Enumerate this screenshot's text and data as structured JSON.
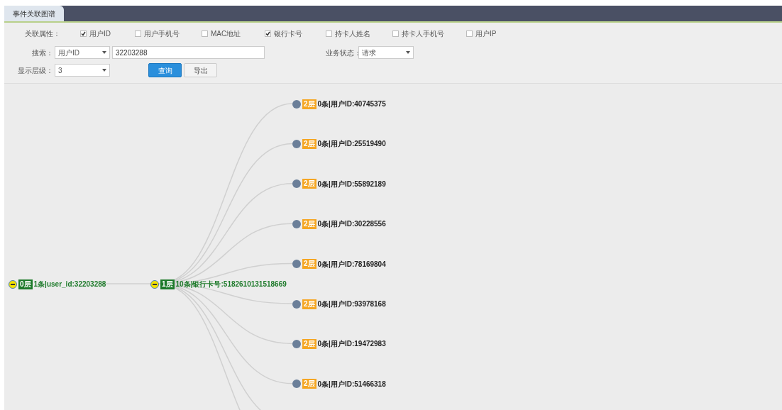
{
  "tabs": [
    {
      "label": "事件关联图谱",
      "selected": true
    }
  ],
  "form": {
    "attributes_label": "关联属性：",
    "attributes": [
      {
        "label": "用户ID",
        "checked": true
      },
      {
        "label": "用户手机号",
        "checked": false
      },
      {
        "label": "MAC地址",
        "checked": false
      },
      {
        "label": "银行卡号",
        "checked": true
      },
      {
        "label": "持卡人姓名",
        "checked": false
      },
      {
        "label": "持卡人手机号",
        "checked": false
      },
      {
        "label": "用户IP",
        "checked": false
      }
    ],
    "search_label": "搜索：",
    "search_type": "用户ID",
    "search_value": "32203288",
    "status_label": "业务状态：",
    "status_value": "请求",
    "depth_label": "显示层级：",
    "depth_value": "3",
    "buttons": [
      {
        "label": "查询",
        "primary": true
      },
      {
        "label": "导出",
        "primary": false
      }
    ]
  },
  "graph": {
    "root": {
      "level": "0层",
      "text": "1条|user_id:32203288",
      "expanded": true,
      "color": "#1d7a2a",
      "children": [
        {
          "level": "1层",
          "text": "10条|银行卡号:5182610131518669",
          "expanded": true,
          "color": "#1d7a2a",
          "children": [
            {
              "level": "2层",
              "text": "0条|用户ID:40745375",
              "expanded": false,
              "color": "#f5a623"
            },
            {
              "level": "2层",
              "text": "0条|用户ID:25519490",
              "expanded": false,
              "color": "#f5a623"
            },
            {
              "level": "2层",
              "text": "0条|用户ID:55892189",
              "expanded": false,
              "color": "#f5a623"
            },
            {
              "level": "2层",
              "text": "0条|用户ID:30228556",
              "expanded": false,
              "color": "#f5a623"
            },
            {
              "level": "2层",
              "text": "0条|用户ID:78169804",
              "expanded": false,
              "color": "#f5a623"
            },
            {
              "level": "2层",
              "text": "0条|用户ID:93978168",
              "expanded": false,
              "color": "#f5a623"
            },
            {
              "level": "2层",
              "text": "0条|用户ID:19472983",
              "expanded": false,
              "color": "#f5a623"
            },
            {
              "level": "2层",
              "text": "0条|用户ID:51466318",
              "expanded": false,
              "color": "#f5a623"
            }
          ]
        }
      ]
    }
  }
}
